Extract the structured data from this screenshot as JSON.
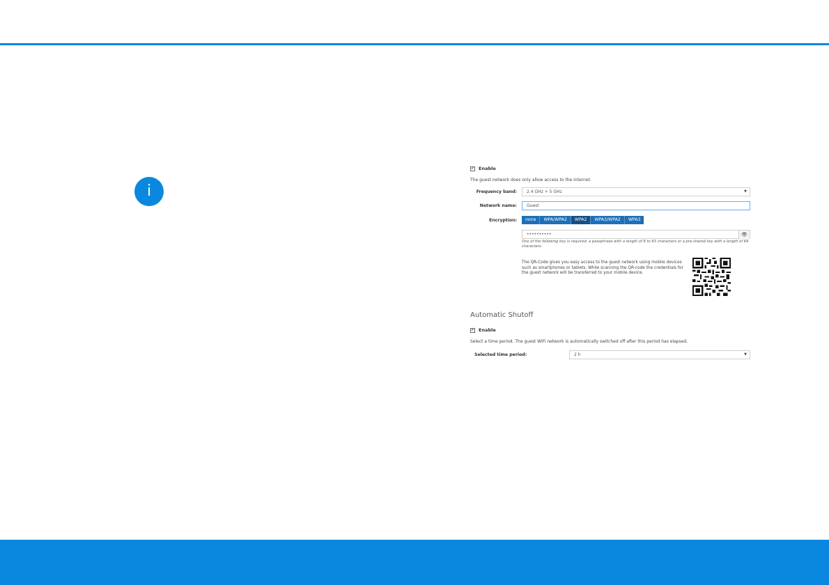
{
  "guest_wifi": {
    "enable_label": "Enable",
    "note": "The guest network does only allow access to the internet.",
    "frequency_band": {
      "label": "Frequency band:",
      "value": "2.4 GHz + 5 GHz"
    },
    "network_name": {
      "label": "Network name:",
      "value": "Guest"
    },
    "encryption": {
      "label": "Encryption:",
      "options": [
        "none",
        "WPA/WPA2",
        "WPA2",
        "WPA3/WPA2",
        "WPA3"
      ],
      "selected": "WPA2"
    },
    "key": {
      "value": "••••••••••",
      "hint": "One of the following key is required: a passphrase with a length of 8 to 63 characters or a pre-shared key with a length of 64 characters."
    },
    "qr_text": "The QR-Code gives you easy access to the guest network using mobile devices such as smartphones or tablets. While scanning the QR-code the credentials for the guest network will be transferred to your mobile device."
  },
  "auto_shutoff": {
    "heading": "Automatic Shutoff",
    "enable_label": "Enable",
    "note": "Select a time period. The guest WiFi network is automatically switched off after this period has elapsed.",
    "time_period": {
      "label": "Selected time period:",
      "value": "2 h"
    }
  },
  "icons": {
    "info": "info-icon",
    "checkbox": "checkbox-checked-icon",
    "dropdown": "chevron-down-icon",
    "eye": "eye-icon",
    "qr": "qr-code-icon"
  },
  "colors": {
    "accent": "#0a88e0",
    "button": "#1d70b8",
    "button_active": "#154f86"
  },
  "glyphs": {
    "info": "i",
    "check": "✔",
    "caret": "▼",
    "eye": "👁"
  }
}
